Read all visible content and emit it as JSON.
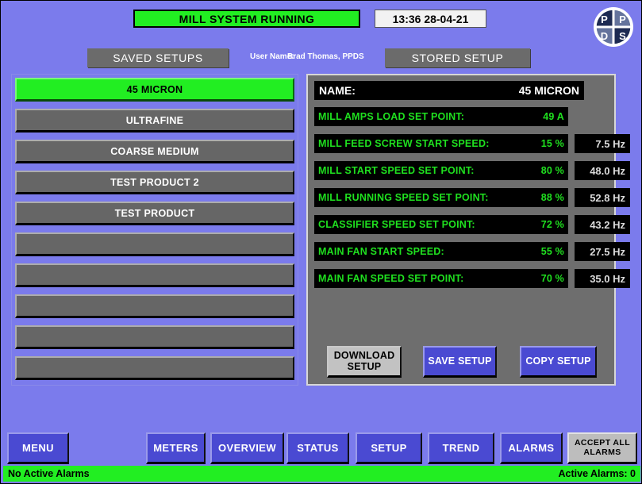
{
  "header": {
    "system_status": "MILL SYSTEM RUNNING",
    "clock": "13:36 28-04-21",
    "status_color": "#22ee22",
    "logo_letters": [
      "P",
      "P",
      "D",
      "S"
    ]
  },
  "sections": {
    "saved_setups_label": "SAVED SETUPS",
    "stored_setup_label": "STORED SETUP",
    "user_name_label": "User Name:",
    "user_name_value": "Brad Thomas, PPDS"
  },
  "saved_setups": [
    {
      "label": "45 MICRON",
      "selected": true,
      "empty": false
    },
    {
      "label": "ULTRAFINE",
      "selected": false,
      "empty": false
    },
    {
      "label": "COARSE MEDIUM",
      "selected": false,
      "empty": false
    },
    {
      "label": "TEST PRODUCT 2",
      "selected": false,
      "empty": false
    },
    {
      "label": "TEST PRODUCT",
      "selected": false,
      "empty": false
    },
    {
      "label": "",
      "selected": false,
      "empty": true
    },
    {
      "label": "",
      "selected": false,
      "empty": true
    },
    {
      "label": "",
      "selected": false,
      "empty": true
    },
    {
      "label": "",
      "selected": false,
      "empty": true
    },
    {
      "label": "",
      "selected": false,
      "empty": true
    }
  ],
  "stored_setup": {
    "name_label": "NAME:",
    "name_value": "45 MICRON",
    "parameters": [
      {
        "label": "MILL AMPS LOAD SET POINT:",
        "value": "49 A",
        "hz": ""
      },
      {
        "label": "MILL FEED SCREW START SPEED:",
        "value": "15 %",
        "hz": "7.5 Hz"
      },
      {
        "label": "MILL START SPEED SET POINT:",
        "value": "80 %",
        "hz": "48.0 Hz"
      },
      {
        "label": "MILL RUNNING SPEED SET POINT:",
        "value": "88 %",
        "hz": "52.8 Hz"
      },
      {
        "label": "CLASSIFIER SPEED SET POINT:",
        "value": "72 %",
        "hz": "43.2 Hz"
      },
      {
        "label": "MAIN FAN START SPEED:",
        "value": "55 %",
        "hz": "27.5 Hz"
      },
      {
        "label": "MAIN FAN SPEED SET POINT:",
        "value": "70 %",
        "hz": "35.0 Hz"
      }
    ],
    "actions": {
      "download": "DOWNLOAD SETUP",
      "save": "SAVE SETUP",
      "copy": "COPY SETUP"
    }
  },
  "nav": {
    "menu": "MENU",
    "meters": "METERS",
    "overview": "OVERVIEW",
    "status": "STATUS",
    "setup": "SETUP",
    "trend": "TREND",
    "alarms": "ALARMS",
    "accept_all_alarms": "ACCEPT ALL ALARMS"
  },
  "alarm_bar": {
    "message": "No Active Alarms",
    "count_label": "Active Alarms:  0",
    "color": "#22ee22"
  }
}
